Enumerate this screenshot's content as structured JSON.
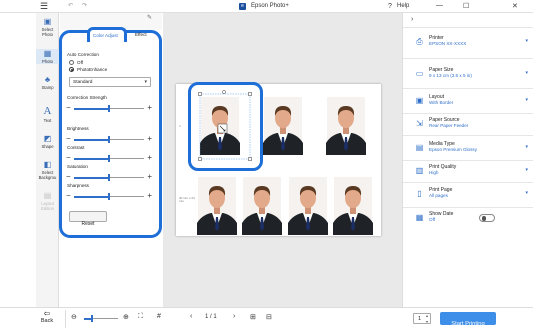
{
  "titlebar": {
    "app_title": "Epson Photo+",
    "help_label": "Help",
    "app_icon_letter": "e",
    "icons": [
      "menu-icon",
      "undo-icon",
      "redo-icon",
      "help-icon",
      "minimize-icon",
      "maximize-icon",
      "close-icon"
    ]
  },
  "nav": {
    "items": [
      {
        "label": "Select Photo",
        "icon": "photo-icon",
        "enabled": true
      },
      {
        "label": "Photo",
        "icon": "photo-adjust-icon",
        "enabled": true
      },
      {
        "label": "Stamp",
        "icon": "stamp-icon",
        "enabled": true
      },
      {
        "label": "Text",
        "icon": "text-icon",
        "enabled": true
      },
      {
        "label": "Shape",
        "icon": "shape-icon",
        "enabled": true
      },
      {
        "label": "Select Backgrou",
        "icon": "background-icon",
        "enabled": true
      },
      {
        "label": "Layout Edition",
        "icon": "layout-edition-icon",
        "enabled": false
      }
    ]
  },
  "panel": {
    "tabs": [
      "Color Adjust",
      "Effect"
    ],
    "active_tab": "Color Adjust",
    "auto_correction_label": "Auto Correction",
    "radio_off": "Off",
    "radio_enhance": "PhotoEnhance",
    "selected_radio": "PhotoEnhance",
    "mode_select": "Standard",
    "sliders": [
      {
        "label": "Correction Strength",
        "value": 0.5
      },
      {
        "label": "Brightness",
        "value": 0.5
      },
      {
        "label": "Contrast",
        "value": 0.5
      },
      {
        "label": "Saturation",
        "value": 0.5
      },
      {
        "label": "Sharpness",
        "value": 0.5
      }
    ],
    "reset_label": "Reset"
  },
  "preview": {
    "row_labels": [
      "30 mm x 24 mm"
    ],
    "photos": 7,
    "selected_photo": 1
  },
  "settings": [
    {
      "title": "Printer",
      "value": "EPSON XX-XXXX",
      "icon": "printer-icon"
    },
    {
      "title": "Paper Size",
      "value": "9 x 13 cm (3.5 x 5 in)",
      "icon": "paper-size-icon"
    },
    {
      "title": "Layout",
      "value": "With Border",
      "icon": "layout-icon"
    },
    {
      "title": "Paper Source",
      "value": "Rear Paper Feeder",
      "icon": "paper-source-icon"
    },
    {
      "title": "Media Type",
      "value": "Epson Premium Glossy",
      "icon": "media-type-icon"
    },
    {
      "title": "Print Quality",
      "value": "High",
      "icon": "print-quality-icon"
    },
    {
      "title": "Print Page",
      "value": "All pages",
      "icon": "print-page-icon"
    },
    {
      "title": "Show Date",
      "value": "Off",
      "icon": "show-date-icon"
    }
  ],
  "bottombar": {
    "back_label": "Back",
    "page_indicator": "1 / 1",
    "copies": "1",
    "start_label": "Start Printing"
  },
  "colors": {
    "accent": "#2f6fc9",
    "highlight_border": "#1e6ed8",
    "start_button": "#3d8ee8"
  }
}
